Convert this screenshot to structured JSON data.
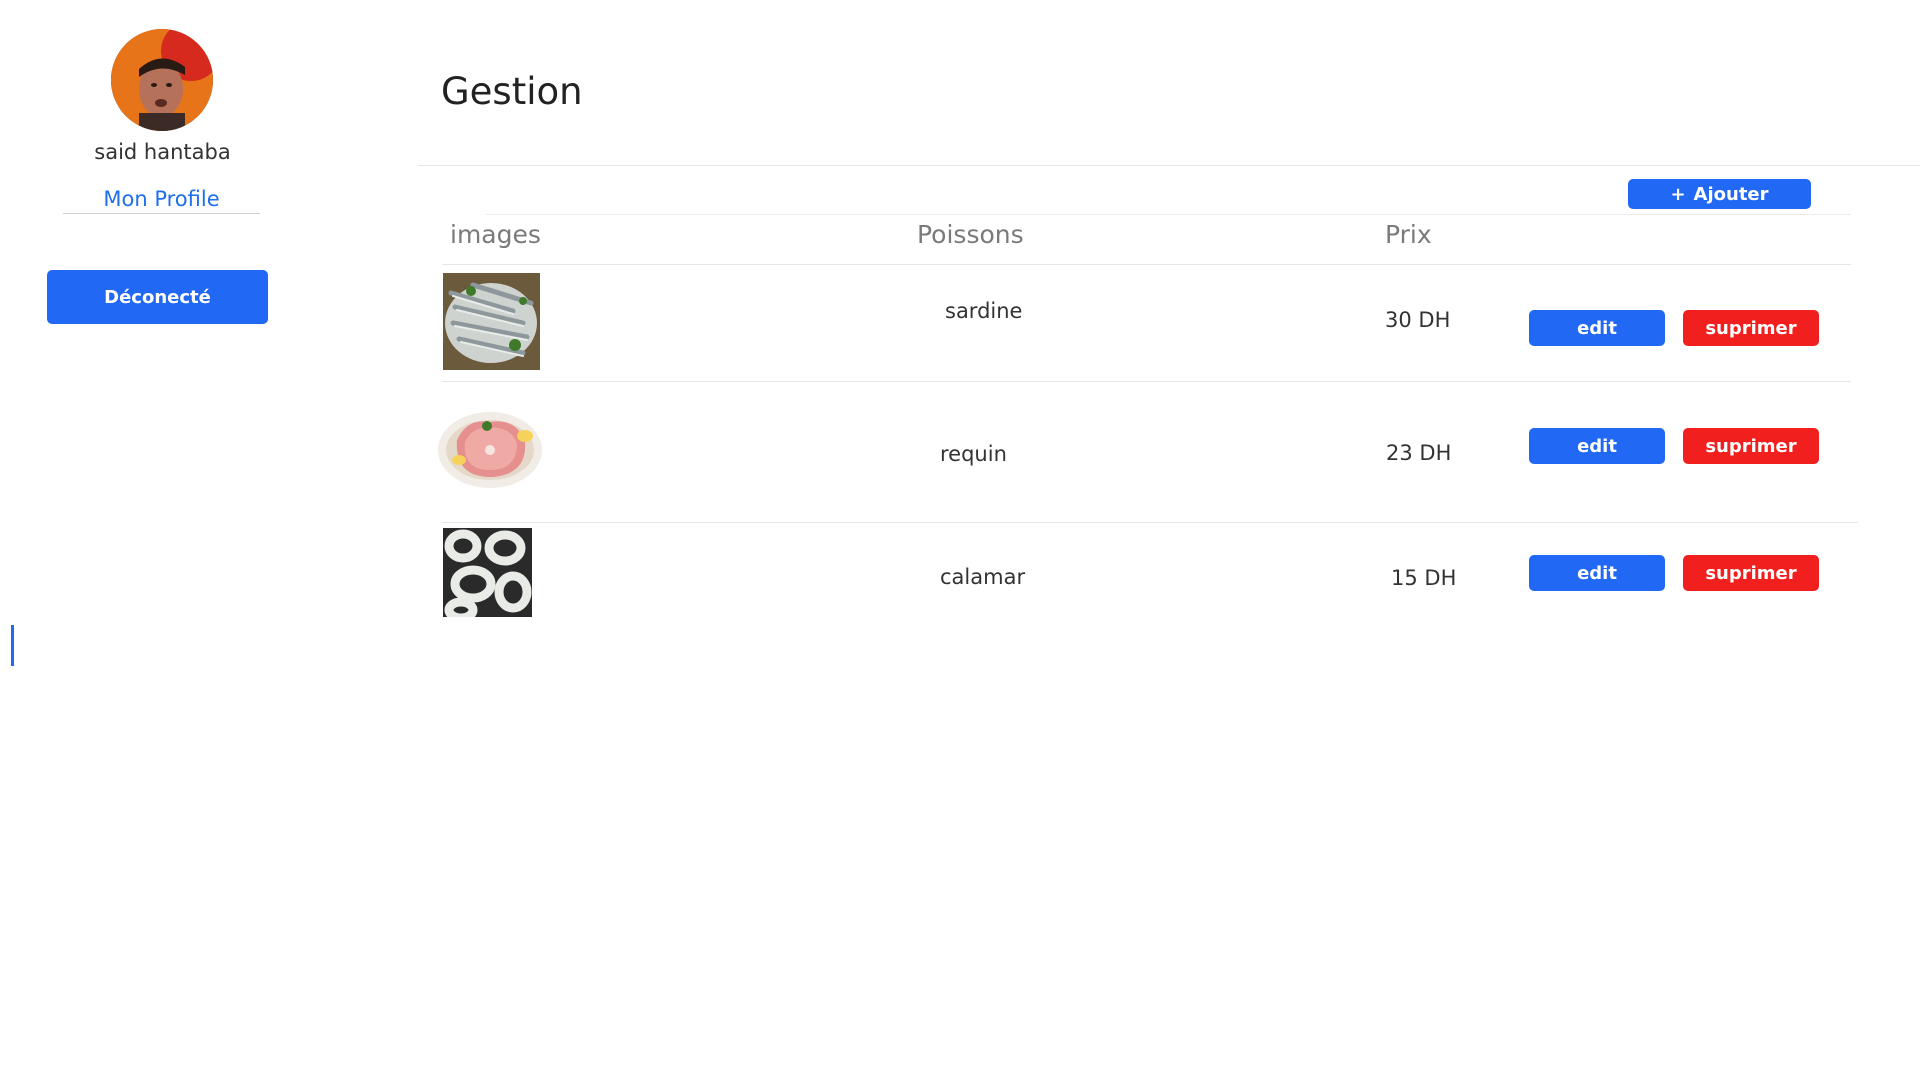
{
  "user": {
    "name": "said hantaba"
  },
  "sidebar": {
    "profile_link": "Mon Profile",
    "logout_label": "Déconecté"
  },
  "page": {
    "title": "Gestion"
  },
  "toolbar": {
    "add_icon": "+",
    "add_label": "Ajouter"
  },
  "table": {
    "headers": {
      "images": "images",
      "poissons": "Poissons",
      "prix": "Prix"
    },
    "rows": [
      {
        "image": "sardine-image",
        "name": "sardine",
        "price": "30 DH",
        "edit_label": "edit",
        "delete_label": "suprimer"
      },
      {
        "image": "requin-image",
        "name": "requin",
        "price": "23 DH",
        "edit_label": "edit",
        "delete_label": "suprimer"
      },
      {
        "image": "calamar-image",
        "name": "calamar",
        "price": "15 DH",
        "edit_label": "edit",
        "delete_label": "suprimer"
      }
    ]
  },
  "colors": {
    "primary": "#2168f5",
    "danger": "#f21f1f",
    "text": "#333333",
    "muted": "#7a7a7a"
  }
}
